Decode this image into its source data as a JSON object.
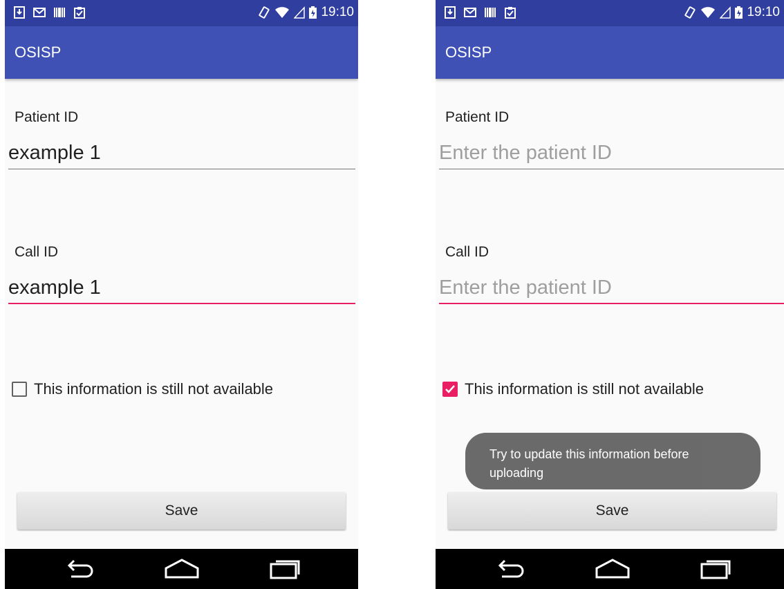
{
  "status_bar": {
    "time": "19:10",
    "icons": [
      "download-icon",
      "gmail-icon",
      "barcode-icon",
      "clipboard-icon",
      "vibrate-icon",
      "wifi-icon",
      "signal-icon",
      "battery-icon"
    ]
  },
  "app": {
    "title": "OSISP",
    "primary_color": "#3f51b5",
    "status_color": "#303f9f",
    "accent_color": "#e91e63"
  },
  "screens": [
    {
      "patient_id": {
        "label": "Patient ID",
        "value": "example 1",
        "placeholder": ""
      },
      "call_id": {
        "label": "Call ID",
        "value": "example 1",
        "placeholder": ""
      },
      "checkbox": {
        "label": "This information is still not available",
        "checked": false
      },
      "save_label": "Save"
    },
    {
      "patient_id": {
        "label": "Patient ID",
        "value": "",
        "placeholder": "Enter the patient ID"
      },
      "call_id": {
        "label": "Call ID",
        "value": "",
        "placeholder": "Enter the patient ID"
      },
      "checkbox": {
        "label": "This information is still not available",
        "checked": true
      },
      "toast": "Try to update this information before uploading",
      "save_label": "Save"
    }
  ],
  "nav_bar": {
    "icons": [
      "back-icon",
      "home-icon",
      "recents-icon"
    ]
  }
}
